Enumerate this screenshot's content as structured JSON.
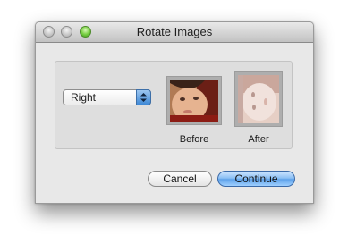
{
  "window": {
    "title": "Rotate Images"
  },
  "rotation": {
    "selected": "Right"
  },
  "preview": {
    "before_label": "Before",
    "after_label": "After"
  },
  "buttons": {
    "cancel_label": "Cancel",
    "continue_label": "Continue"
  },
  "colors": {
    "default_button": "#5ea2ea",
    "zoom_button": "#7bd146"
  }
}
